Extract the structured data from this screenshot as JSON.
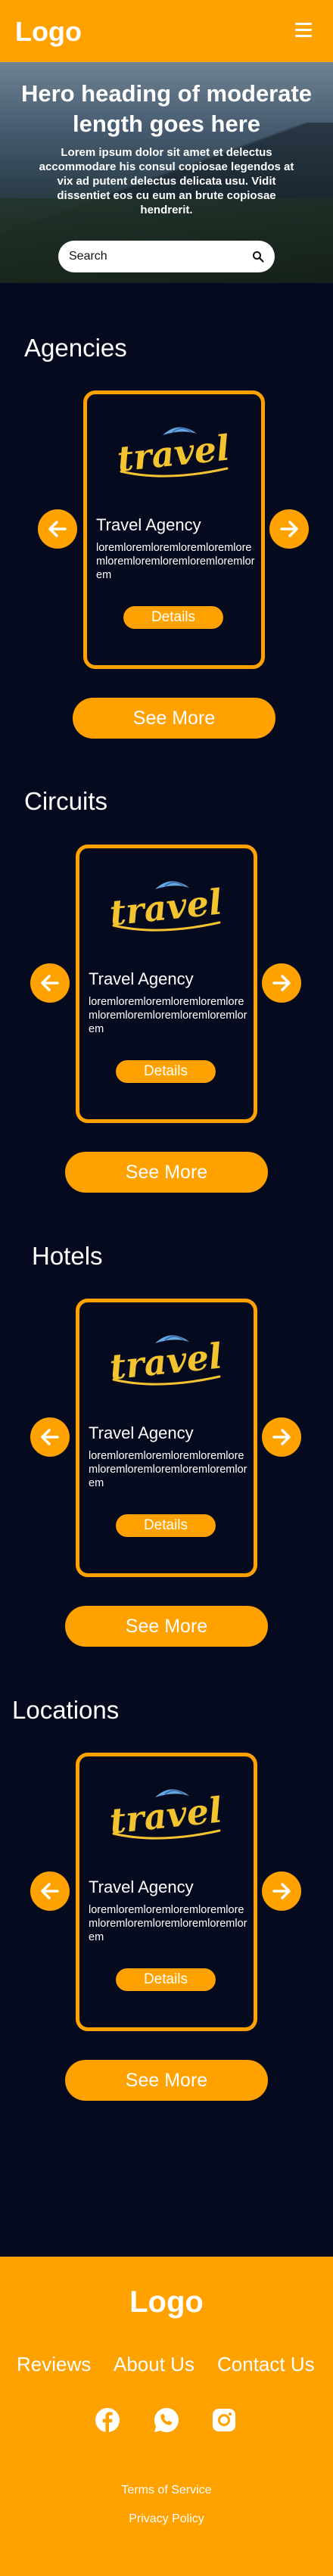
{
  "header": {
    "logo": "Logo",
    "menu_icon": "hamburger-menu-icon"
  },
  "hero": {
    "heading": "Hero heading of moderate length goes here",
    "text": "Lorem ipsum dolor sit amet et delectus accommodare his consul copiosae legendos at vix ad putent delectus delicata usu. Vidit dissentiet eos cu eum an brute copiosae hendrerit.",
    "search_placeholder": "Search",
    "search_icon": "search-icon"
  },
  "sections": [
    {
      "title": "Agencies",
      "card": {
        "brand_text": "travel",
        "title": "Travel Agency",
        "description": "loremloremloremloremloremloremloremloremloremloremloremlorem",
        "details_label": "Details"
      },
      "see_more": "See More"
    },
    {
      "title": "Circuits",
      "card": {
        "brand_text": "travel",
        "title": "Travel Agency",
        "description": "loremloremloremloremloremloremloremloremloremloremloremlorem",
        "details_label": "Details"
      },
      "see_more": "See More"
    },
    {
      "title": "Hotels",
      "card": {
        "brand_text": "travel",
        "title": "Travel Agency",
        "description": "loremloremloremloremloremloremloremloremloremloremloremlorem",
        "details_label": "Details"
      },
      "see_more": "See More"
    },
    {
      "title": "Locations",
      "card": {
        "brand_text": "travel",
        "title": "Travel Agency",
        "description": "loremloremloremloremloremloremloremloremloremloremloremlorem",
        "details_label": "Details"
      },
      "see_more": "See More"
    }
  ],
  "footer": {
    "logo": "Logo",
    "links": [
      "Reviews",
      "About Us",
      "Contact Us"
    ],
    "socials": [
      "facebook-icon",
      "whatsapp-icon",
      "instagram-icon"
    ],
    "terms": "Terms of Service",
    "privacy": "Privacy Policy"
  },
  "colors": {
    "accent": "#ffa200",
    "background": "#050a1e",
    "text": "#ffffff"
  }
}
